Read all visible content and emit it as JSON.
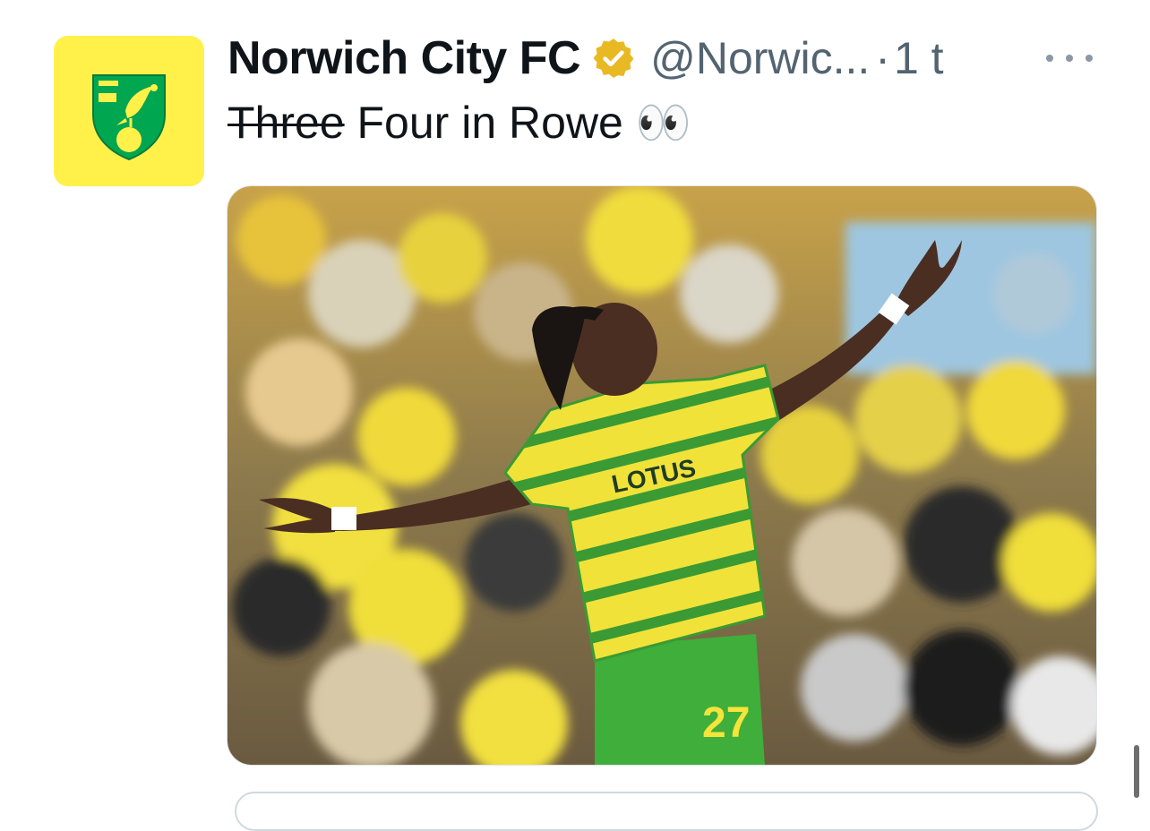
{
  "tweet": {
    "author_name": "Norwich City FC",
    "verified_icon": "gold-verified-badge-icon",
    "handle": "@Norwic...",
    "separator": "·",
    "time": "1 t",
    "text_struck": "Three",
    "text_rest": " Four in Rowe ",
    "text_emoji": "👀",
    "more_icon": "ellipsis-icon"
  },
  "media": {
    "shirt_sponsor": "LOTUS",
    "shirt_number": "27"
  },
  "colors": {
    "avatar_bg": "#fff14a",
    "crest_green": "#00a650",
    "kit_yellow": "#f5e43a",
    "kit_green": "#3fae3a",
    "verified_gold": "#e8b923"
  }
}
